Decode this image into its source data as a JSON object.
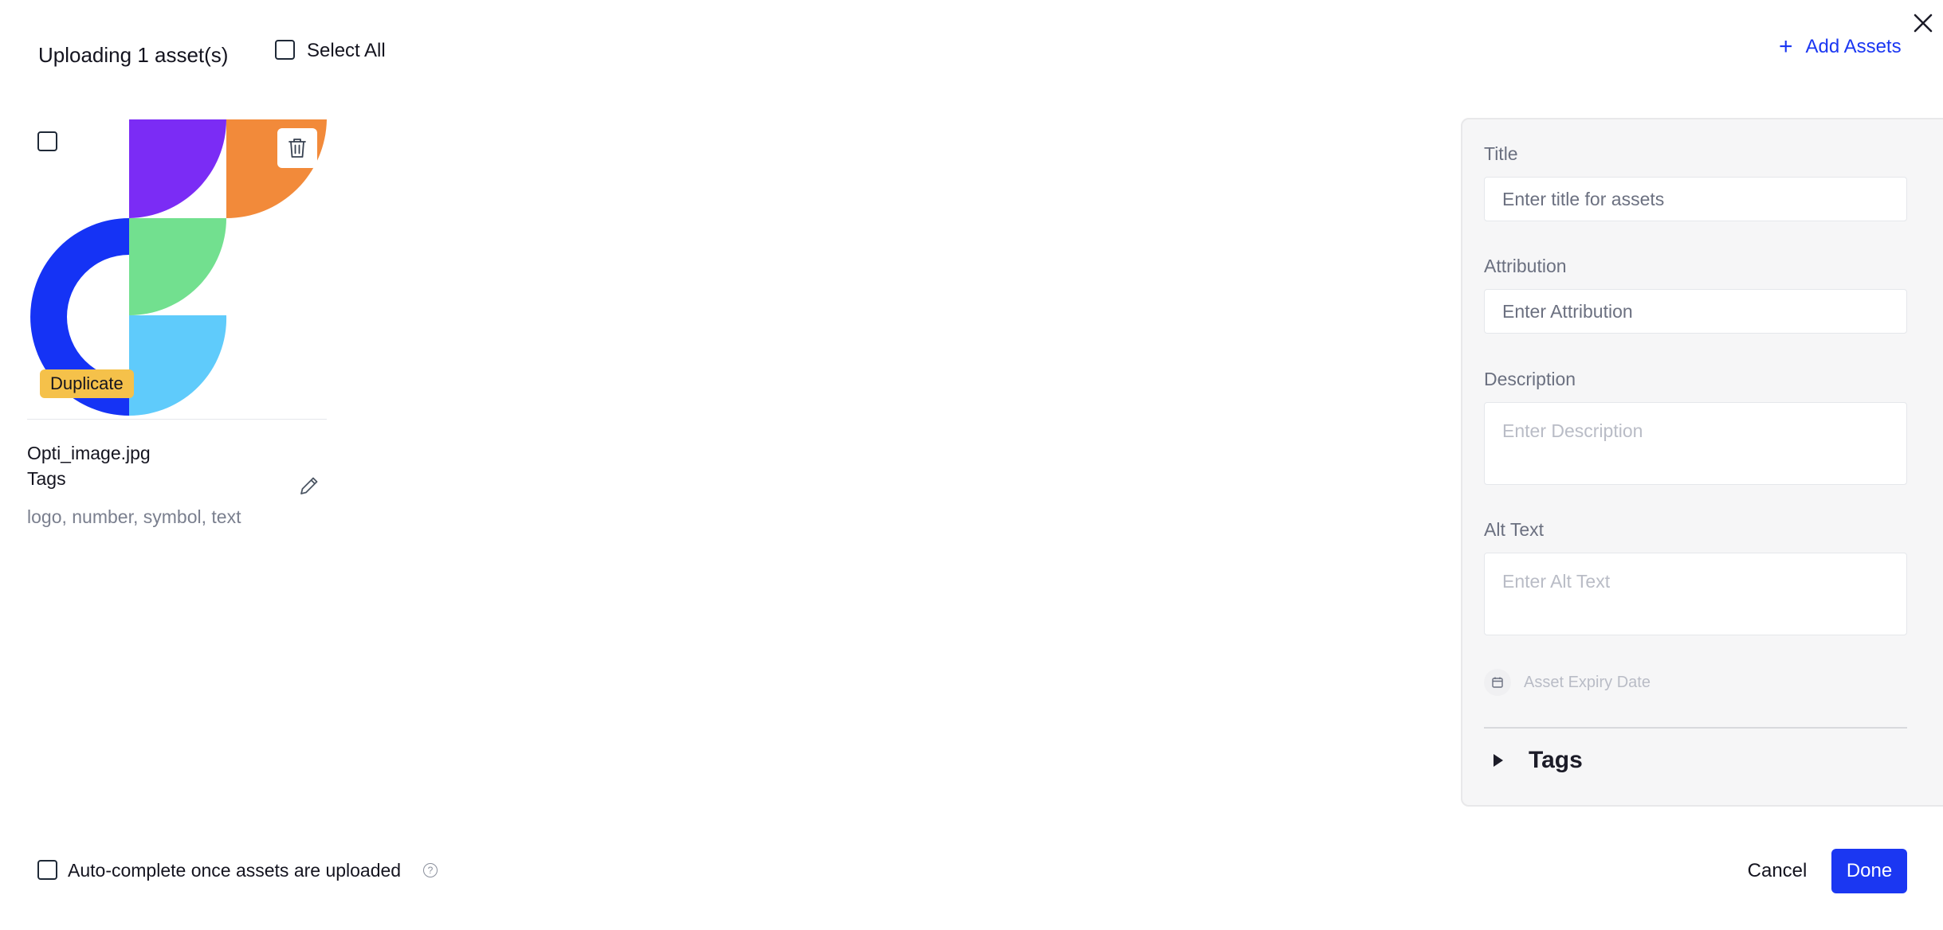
{
  "header": {
    "title": "Uploading 1 asset(s)",
    "select_all_label": "Select All",
    "add_assets_label": "Add Assets",
    "close_icon": "close-icon",
    "add_icon": "plus-icon"
  },
  "asset": {
    "file_name": "Opti_image.jpg",
    "badge": "Duplicate",
    "tags_label": "Tags",
    "tags_value": "logo, number, symbol, text",
    "delete_icon": "trash-icon",
    "edit_icon": "pencil-icon"
  },
  "panel": {
    "title_label": "Title",
    "title_placeholder": "Enter title for assets",
    "attribution_label": "Attribution",
    "attribution_placeholder": "Enter Attribution",
    "description_label": "Description",
    "description_placeholder": "Enter Description",
    "alt_text_label": "Alt Text",
    "alt_text_placeholder": "Enter Alt Text",
    "expiry_label": "Asset Expiry Date",
    "tags_section_label": "Tags"
  },
  "footer": {
    "auto_complete_label": "Auto-complete once assets are uploaded",
    "help_icon": "?",
    "cancel_label": "Cancel",
    "done_label": "Done"
  },
  "colors": {
    "accent": "#1b37f2",
    "badge": "#f5c14a",
    "logo_blue": "#1533f5",
    "logo_purple": "#7b2cf5",
    "logo_orange": "#f28a3a",
    "logo_green": "#72e08f",
    "logo_light_blue": "#5fcbfb"
  }
}
